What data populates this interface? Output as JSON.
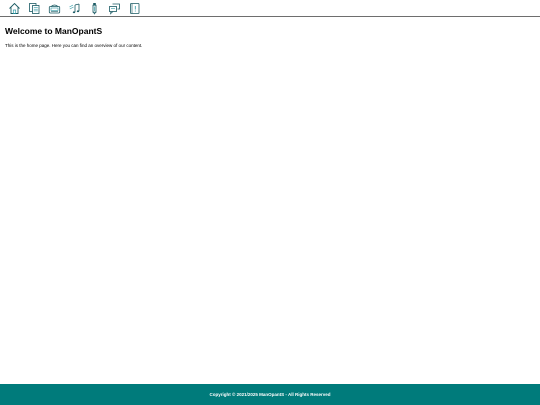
{
  "toolbar": {
    "items": [
      {
        "icon": "home-icon"
      },
      {
        "icon": "documents-icon"
      },
      {
        "icon": "cassette-player-icon"
      },
      {
        "icon": "music-notes-icon"
      },
      {
        "icon": "marker-icon"
      },
      {
        "icon": "chat-bubbles-icon"
      },
      {
        "icon": "book-icon"
      }
    ]
  },
  "main": {
    "title": "Welcome to ManOpantS",
    "intro": "This is the home page. Here you can find an overview of our content."
  },
  "footer": {
    "text": "Copyright © 2021/2025 ManOpantS - All Rights Reserved"
  },
  "colors": {
    "footer_bg": "#007b7b",
    "icon_stroke": "#1a5a63",
    "icon_accent": "#2f9aa6"
  }
}
